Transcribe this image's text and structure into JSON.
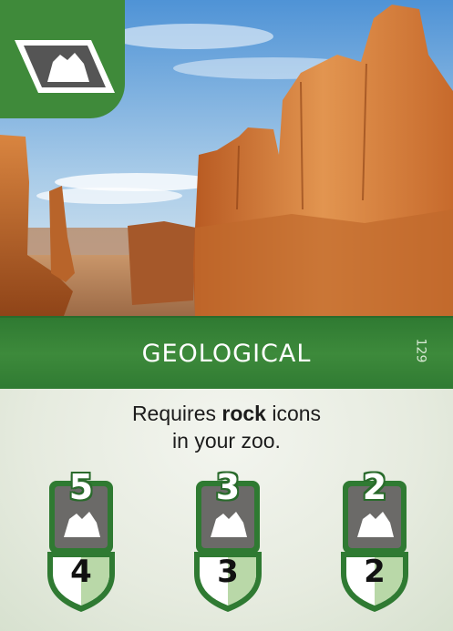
{
  "card": {
    "title": "GEOLOGICAL",
    "number": "129",
    "requirement": {
      "prefix": "Requires ",
      "bold": "rock",
      "suffix": " icons",
      "line2": "in your zoo."
    },
    "corner_icon": "rock-icon",
    "tiers": [
      {
        "icons_required": "5",
        "points": "4"
      },
      {
        "icons_required": "3",
        "points": "3"
      },
      {
        "icons_required": "2",
        "points": "2"
      }
    ],
    "colors": {
      "green": "#3f8a3a",
      "dark_green": "#2a6b2c",
      "rock_panel": "#6b6a68",
      "light_green": "#b9d8a8"
    }
  }
}
